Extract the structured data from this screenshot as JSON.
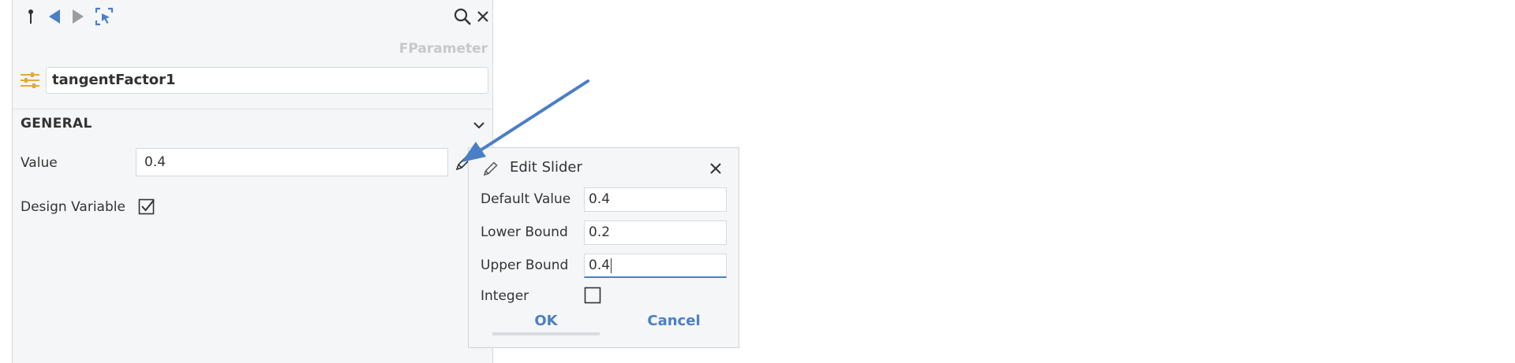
{
  "toolbar": {
    "icons": [
      "pin-icon",
      "back-icon",
      "forward-icon",
      "select-icon",
      "search-icon",
      "close-icon"
    ]
  },
  "header": {
    "type_label": "FParameter",
    "name_value": "tangentFactor1"
  },
  "section": {
    "title": "GENERAL"
  },
  "fields": {
    "value_label": "Value",
    "value": "0.4",
    "design_variable_label": "Design Variable",
    "design_variable_checked": true
  },
  "dialog": {
    "title": "Edit Slider",
    "default_value_label": "Default Value",
    "default_value": "0.4",
    "lower_bound_label": "Lower Bound",
    "lower_bound": "0.2",
    "upper_bound_label": "Upper Bound",
    "upper_bound": "0.4",
    "integer_label": "Integer",
    "integer_checked": false,
    "ok_label": "OK",
    "cancel_label": "Cancel"
  },
  "colors": {
    "accent": "#4a7fc6",
    "panel_bg": "#f5f6f7",
    "border": "#d6d9dc",
    "muted_text": "#c6c9cc",
    "slider_icon": "#e2a93a"
  }
}
